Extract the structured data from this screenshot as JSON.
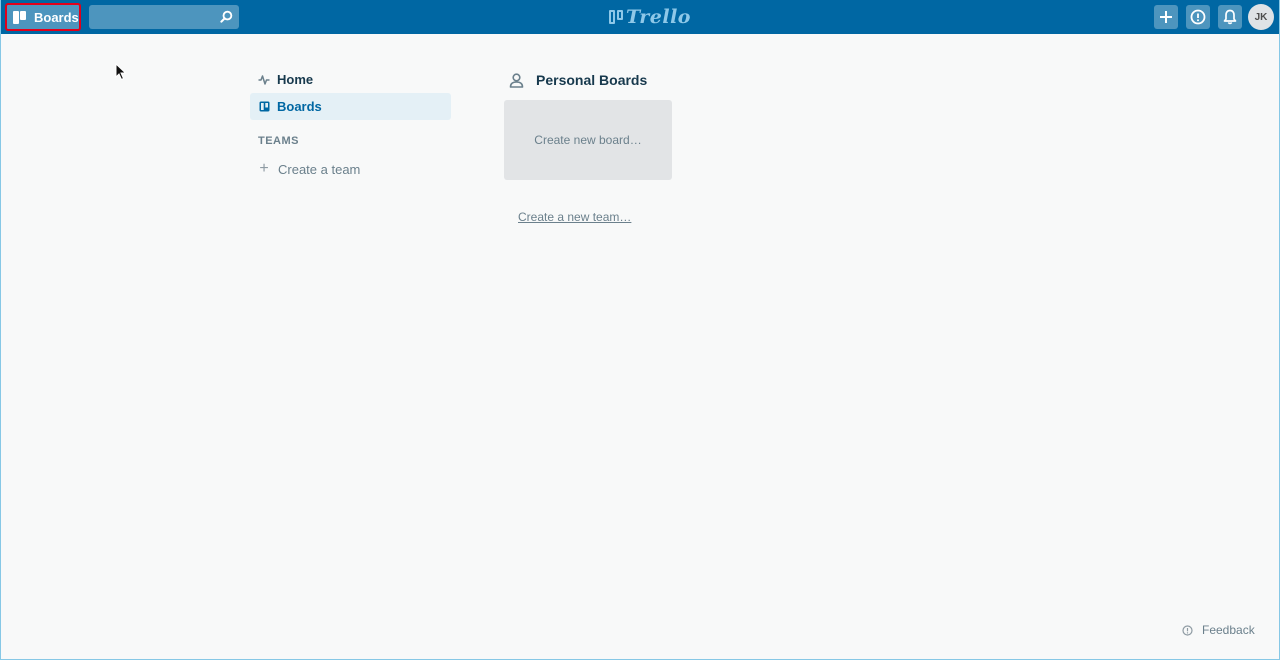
{
  "header": {
    "boards_label": "Boards",
    "search": {
      "value": "",
      "placeholder": ""
    },
    "logo_text": "Trello",
    "avatar_initials": "JK",
    "buttons": [
      "plus-icon",
      "info-icon",
      "bell-icon"
    ]
  },
  "sidebar": {
    "items": [
      {
        "label": "Home",
        "icon": "activity-icon",
        "active": false
      },
      {
        "label": "Boards",
        "icon": "board-icon",
        "active": true
      }
    ],
    "teams_heading": "TEAMS",
    "create_team_label": "Create a team"
  },
  "main": {
    "personal_boards_title": "Personal Boards",
    "create_board_label": "Create new board…",
    "create_team_link": "Create a new team…"
  },
  "feedback_label": "Feedback",
  "colors": {
    "header_bg": "#0067a3",
    "active_nav_bg": "#e4f0f6",
    "active_nav_text": "#0067a3",
    "highlight_border": "#e2001a"
  }
}
